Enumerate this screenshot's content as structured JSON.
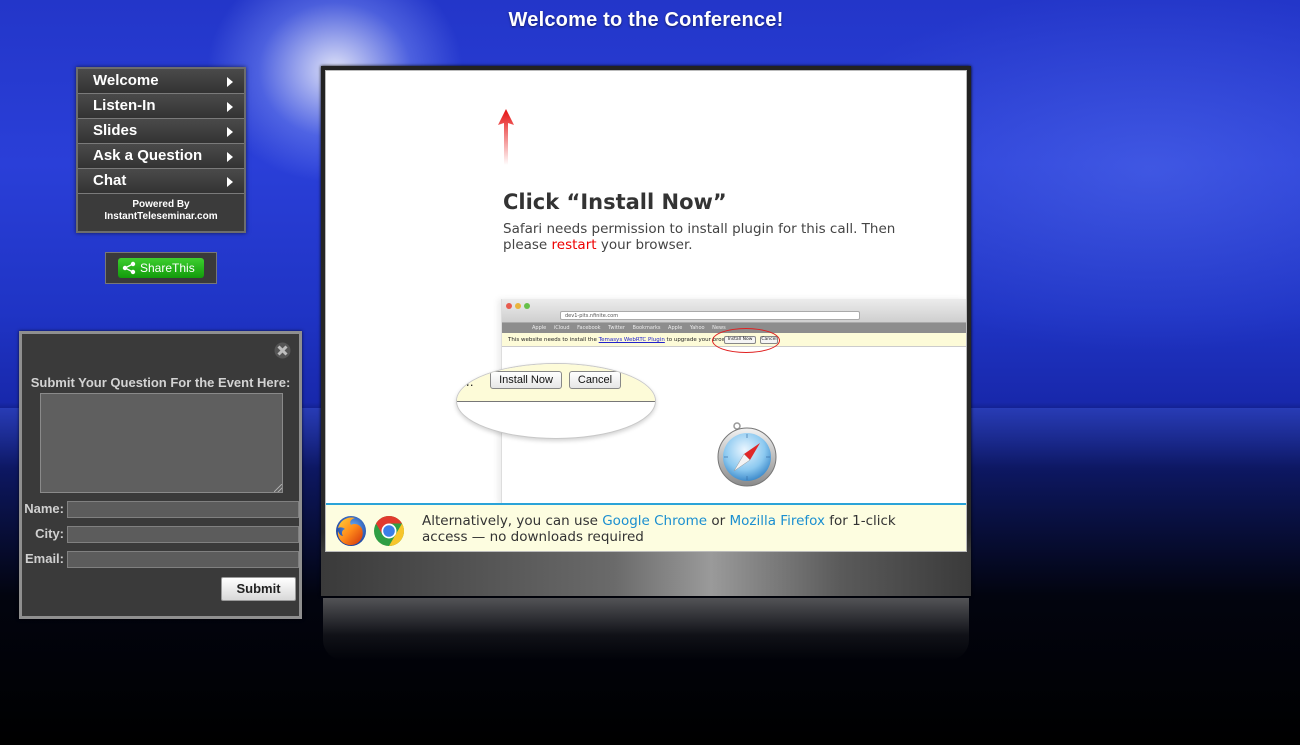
{
  "page": {
    "title": "Welcome to the Conference!"
  },
  "nav": {
    "items": [
      {
        "label": "Welcome"
      },
      {
        "label": "Listen-In"
      },
      {
        "label": "Slides"
      },
      {
        "label": "Ask a Question"
      },
      {
        "label": "Chat"
      }
    ],
    "powered_line1": "Powered By",
    "powered_line2": "InstantTeleseminar.com"
  },
  "share": {
    "label": "ShareThis"
  },
  "question_form": {
    "heading": "Submit Your Question For the Event Here:",
    "question_value": "",
    "name_label": "Name:",
    "city_label": "City:",
    "email_label": "Email:",
    "name_value": "",
    "city_value": "",
    "email_value": "",
    "submit_label": "Submit"
  },
  "instructions": {
    "title": "Click “Install Now”",
    "text_before": "Safari needs permission to install plugin for this call. Then please ",
    "text_highlight": "restart",
    "text_after": " your browser."
  },
  "browser_mock": {
    "url": "dev1-pits.nfinite.com",
    "bookmarks": "Apple iCloud Facebook Twitter Bookmarks Apple Yahoo News",
    "notice_before": "This website needs to install the ",
    "notice_link": "Temasys WebRTC Plugin",
    "notice_after": " to upgrade your browser.",
    "mini_install": "Install Now",
    "mini_cancel": "Cancel",
    "mag_text": "er.",
    "mag_install": "Install Now",
    "mag_cancel": "Cancel"
  },
  "alternatives": {
    "text_before": "Alternatively, you can use ",
    "chrome_link": "Google Chrome",
    "text_middle": " or ",
    "firefox_link": "Mozilla Firefox",
    "text_after": " for 1-click access — no downloads required"
  },
  "icons": {
    "close": "close-icon",
    "arrow": "up-arrow-icon",
    "firefox": "firefox-icon",
    "chrome": "chrome-icon",
    "safari": "safari-icon",
    "share": "share-icon"
  },
  "colors": {
    "accent_blue": "#1b8fd0",
    "highlight_red": "#e00000",
    "share_green": "#22b21a",
    "strip_border": "#2aa3d8"
  }
}
